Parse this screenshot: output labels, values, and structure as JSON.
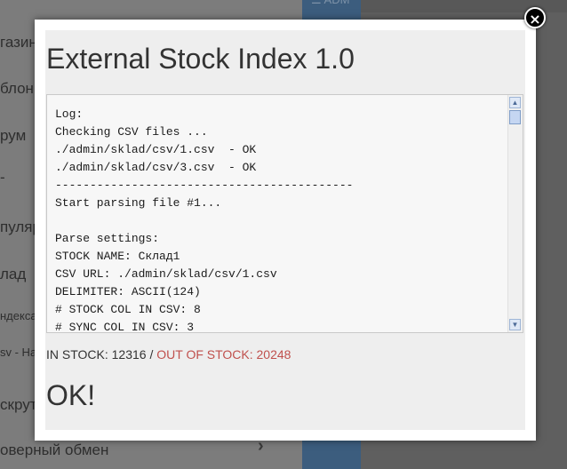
{
  "background": {
    "sidebar_items": [
      "газин",
      "блон",
      "рум",
      "-",
      "пуляр",
      "лад",
      "ндекса",
      "sv - На",
      "скрут",
      "оверный обмен"
    ],
    "header_label": "☰ ADM"
  },
  "modal": {
    "close_label": "×",
    "title": "External Stock Index 1.0",
    "log": "Log:\nChecking CSV files ...\n./admin/sklad/csv/1.csv  - OK\n./admin/sklad/csv/3.csv  - OK\n-------------------------------------------\nStart parsing file #1...\n\nParse settings:\nSTOCK NAME: Склад1\nCSV URL: ./admin/sklad/csv/1.csv\nDELIMITER: ASCII(124)\n# STOCK COL IN CSV: 8\n# SYNC COL IN CSV: 3",
    "in_stock_label": "IN STOCK: 12316",
    "separator": " / ",
    "out_of_stock_label": "OUT OF STOCK: 20248",
    "result": "OK!"
  },
  "colors": {
    "out_of_stock": "#c0504d",
    "overlay": "#6a6a6a",
    "scroll_accent": "#7f9dc8"
  }
}
